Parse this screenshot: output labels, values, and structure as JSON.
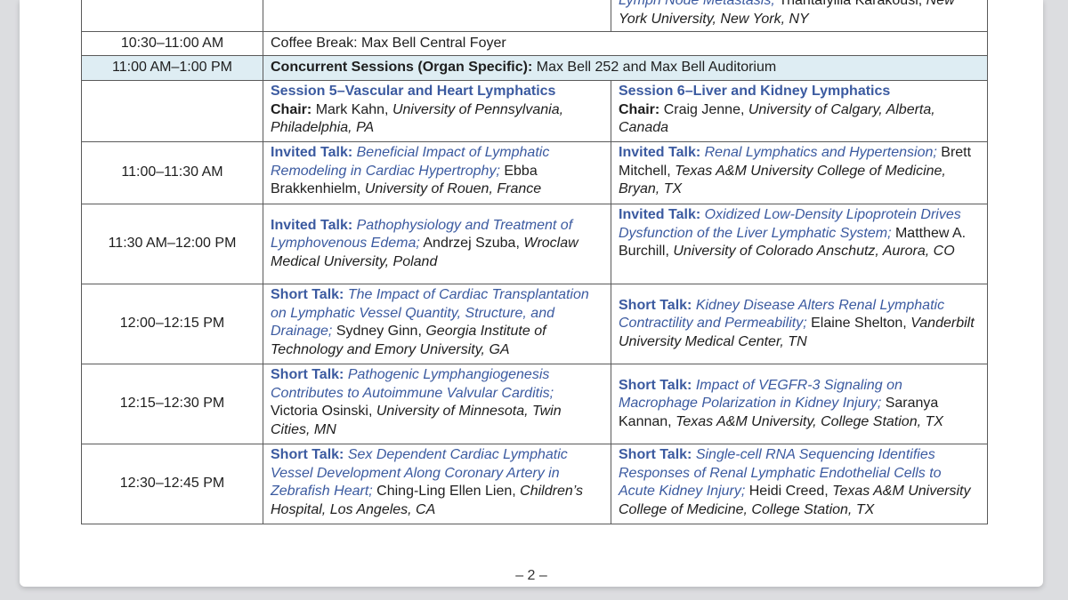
{
  "top_row": {
    "right": {
      "title_tail": "Lymph Node Metastasis;",
      "speaker": "Triantafyllia Karakousi,",
      "affil": "New York University, New York, NY"
    }
  },
  "coffee": {
    "time": "10:30–11:00 AM",
    "text": "Coffee Break: Max Bell Central Foyer"
  },
  "concurrent": {
    "time": "11:00 AM–1:00 PM",
    "label": "Concurrent Sessions (Organ Specific):",
    "text": "Max Bell 252 and Max Bell Auditorium"
  },
  "sessions": {
    "left": {
      "title": "Session 5–Vascular and Heart Lymphatics",
      "chair_label": "Chair:",
      "chair_name": "Mark Kahn,",
      "chair_affil": "University of Pennsylvania, Philadelphia, PA"
    },
    "right": {
      "title": "Session 6–Liver and Kidney Lymphatics",
      "chair_label": "Chair:",
      "chair_name": "Craig Jenne,",
      "chair_affil": "University of Calgary, Alberta, Canada"
    }
  },
  "talks": [
    {
      "time": "11:00–11:30 AM",
      "left": {
        "type": "Invited Talk:",
        "title": "Beneficial Impact of Lymphatic Remodeling in Cardiac Hypertrophy;",
        "speaker": "Ebba Brakkenhielm,",
        "affil": "University of Rouen, France"
      },
      "right": {
        "type": "Invited Talk:",
        "title": "Renal Lymphatics and Hypertension;",
        "speaker": "Brett Mitchell,",
        "affil": "Texas A&M University College of Medicine, Bryan, TX"
      }
    },
    {
      "time": "11:30 AM–12:00 PM",
      "left": {
        "type": "Invited Talk:",
        "title": "Pathophysiology and Treatment of Lymphovenous Edema;",
        "speaker": "Andrzej Szuba,",
        "affil": "Wroclaw Medical University, Poland"
      },
      "right": {
        "type": "Invited Talk:",
        "title": "Oxidized Low-Density Lipoprotein Drives Dysfunction of the Liver Lymphatic System;",
        "speaker": "Matthew A. Burchill,",
        "affil": "University of Colorado Anschutz, Aurora, CO"
      }
    },
    {
      "time": "12:00–12:15 PM",
      "left": {
        "type": "Short Talk:",
        "title": "The Impact of Cardiac Transplantation on Lymphatic Vessel Quantity, Structure, and Drainage;",
        "speaker": "Sydney Ginn,",
        "affil": "Georgia Institute of Technology and Emory University, GA"
      },
      "right": {
        "type": "Short Talk:",
        "title": "Kidney Disease Alters Renal Lymphatic Contractility and Permeability;",
        "speaker": "Elaine Shelton,",
        "affil": "Vanderbilt University Medical Center, TN"
      }
    },
    {
      "time": "12:15–12:30 PM",
      "left": {
        "type": "Short Talk:",
        "title": "Pathogenic Lymphangiogenesis Contributes to Autoimmune Valvular Carditis;",
        "speaker": "Victoria Osinski,",
        "affil": "University of Minnesota, Twin Cities, MN"
      },
      "right": {
        "type": "Short Talk:",
        "title": "Impact of VEGFR-3 Signaling on Macrophage Polarization in Kidney Injury;",
        "speaker": "Saranya Kannan,",
        "affil": "Texas A&M University, College Station, TX"
      }
    },
    {
      "time": "12:30–12:45 PM",
      "left": {
        "type": "Short Talk:",
        "title": "Sex Dependent Cardiac Lymphatic Vessel Development Along Coronary Artery in Zebrafish Heart;",
        "speaker": "Ching-Ling Ellen Lien,",
        "affil": "Children’s Hospital, Los Angeles, CA"
      },
      "right": {
        "type": "Short Talk:",
        "title": "Single-cell RNA Sequencing Identifies Responses of Renal Lymphatic Endothelial Cells to Acute Kidney Injury;",
        "speaker": "Heidi Creed,",
        "affil": "Texas A&M University College of Medicine, College Station, TX"
      }
    }
  ],
  "footer": {
    "page": "– 2 –"
  }
}
